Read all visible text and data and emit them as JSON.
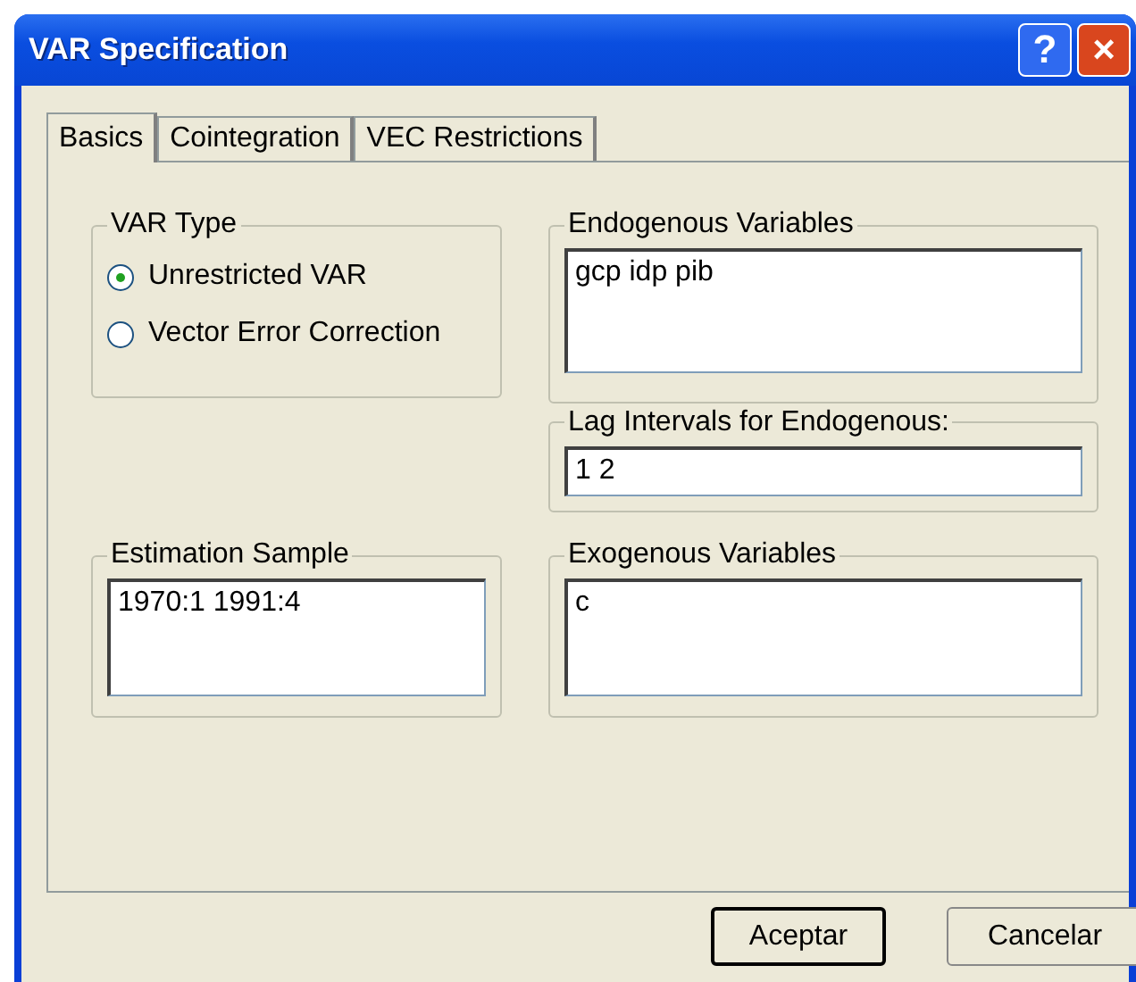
{
  "window": {
    "title": "VAR Specification",
    "controls": [
      "?",
      "×"
    ]
  },
  "tabs": [
    {
      "label": "Basics",
      "selected": true
    },
    {
      "label": "Cointegration",
      "selected": false
    },
    {
      "label": "VEC Restrictions",
      "selected": false
    }
  ],
  "var_type": {
    "title": "VAR Type",
    "options": [
      {
        "label": "Unrestricted VAR",
        "selected": true
      },
      {
        "label": "Vector Error Correction",
        "selected": false
      }
    ]
  },
  "endogenous": {
    "title": "Endogenous Variables",
    "value": "gcp idp pib"
  },
  "lag_intervals": {
    "title": "Lag Intervals for Endogenous:",
    "value": "1 2"
  },
  "estimation_sample": {
    "title": "Estimation Sample",
    "value": "1970:1 1991:4"
  },
  "exogenous": {
    "title": "Exogenous Variables",
    "value": "c"
  },
  "buttons": [
    {
      "label": "Aceptar",
      "default": true
    },
    {
      "label": "Cancelar",
      "default": false
    }
  ]
}
